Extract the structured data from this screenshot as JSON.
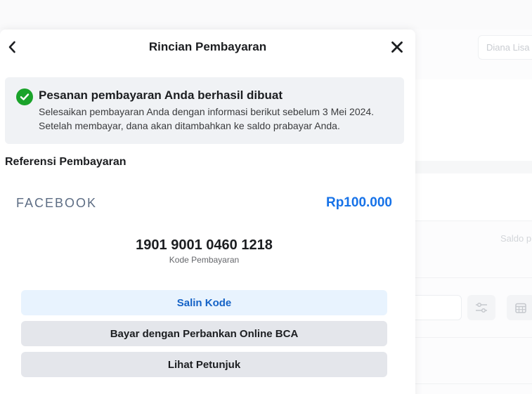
{
  "background": {
    "user_name": "Diana Lisa",
    "saldo_label": "Saldo p"
  },
  "modal": {
    "title": "Rincian Pembayaran",
    "notice": {
      "title": "Pesanan pembayaran Anda berhasil dibuat",
      "body": "Selesaikan pembayaran Anda dengan informasi berikut sebelum 3 Mei 2024. Setelah membayar, dana akan ditambahkan ke saldo prabayar Anda."
    },
    "reference_heading": "Referensi Pembayaran",
    "brand": "FACEBOOK",
    "amount": "Rp100.000",
    "payment_code": "1901 9001 0460 1218",
    "payment_code_label": "Kode Pembayaran",
    "buttons": {
      "copy": "Salin Kode",
      "pay_bca": "Bayar dengan Perbankan Online BCA",
      "instructions": "Lihat Petunjuk"
    }
  },
  "colors": {
    "success": "#1aa32a",
    "amount": "#1672e8",
    "primary_button_bg": "#e8f3fe",
    "primary_button_text": "#1462c6"
  },
  "icons": {
    "back": "chevron-left-icon",
    "close": "close-icon",
    "success": "check-circle-icon",
    "filter": "sliders-icon",
    "calendar": "calendar-icon"
  }
}
